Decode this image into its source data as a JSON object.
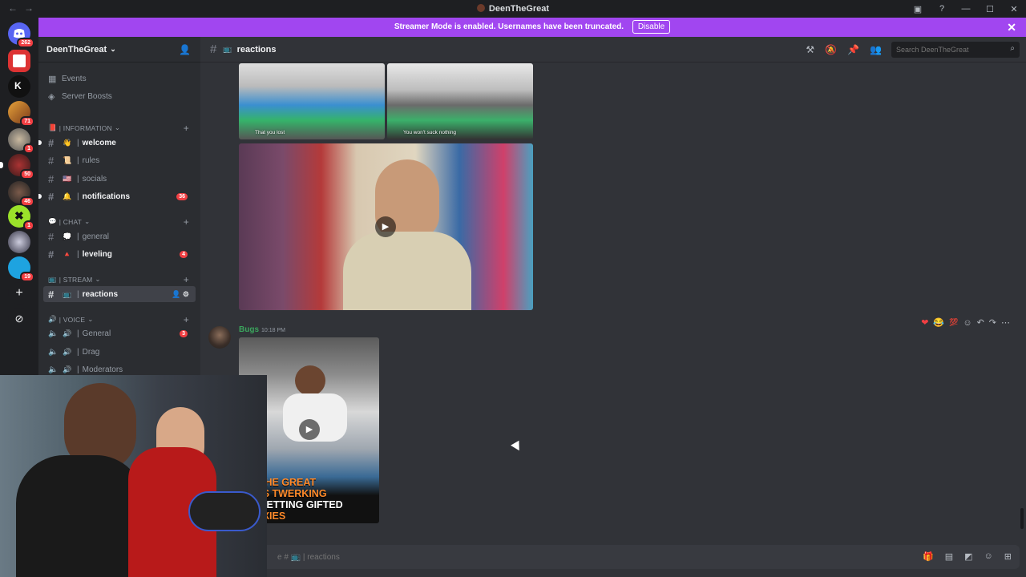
{
  "window": {
    "title": "DeenTheGreat",
    "nav_back": "←",
    "nav_forward": "→"
  },
  "banner": {
    "text": "Streamer Mode is enabled. Usernames have been truncated.",
    "button": "Disable",
    "close": "✕"
  },
  "guilds": [
    {
      "badge": "262"
    },
    {
      "badge": ""
    },
    {
      "badge": ""
    },
    {
      "badge": "71"
    },
    {
      "badge": "1"
    },
    {
      "badge": "50"
    },
    {
      "badge": "46"
    },
    {
      "badge": "1"
    },
    {
      "badge": ""
    },
    {
      "badge": "19"
    }
  ],
  "server": {
    "name": "DeenTheGreat",
    "items": [
      {
        "label": "Events"
      },
      {
        "label": "Server Boosts"
      }
    ],
    "categories": [
      {
        "label": "| INFORMATION",
        "emoji": "📕"
      },
      {
        "label": "| CHAT",
        "emoji": "💬"
      },
      {
        "label": "| STREAM",
        "emoji": "📺"
      },
      {
        "label": "| VOICE",
        "emoji": "🔊"
      }
    ],
    "channels": [
      {
        "name": "welcome",
        "emoji": "👋",
        "prefix": "|"
      },
      {
        "name": "rules",
        "emoji": "📜",
        "prefix": "|"
      },
      {
        "name": "socials",
        "emoji": "🇺🇸",
        "prefix": "|"
      },
      {
        "name": "notifications",
        "emoji": "🔔",
        "prefix": "|",
        "badge": "36"
      },
      {
        "name": "general",
        "emoji": "💭",
        "prefix": "|"
      },
      {
        "name": "leveling",
        "emoji": "🔺",
        "prefix": "|",
        "badge": "4"
      },
      {
        "name": "reactions",
        "emoji": "📺",
        "prefix": "|"
      }
    ],
    "voice": [
      {
        "name": "General",
        "prefix": "|",
        "badge": "3"
      },
      {
        "name": "Drag",
        "prefix": "|"
      },
      {
        "name": "Moderators",
        "prefix": "|"
      }
    ]
  },
  "channel_header": {
    "name": "reactions",
    "emoji": "📺"
  },
  "search": {
    "placeholder": "Search DeenTheGreat"
  },
  "media": {
    "caption_left": "That you lost",
    "caption_right": "You won't suck nothing"
  },
  "message": {
    "author": "Bugs",
    "time": "10:18 PM",
    "video_text_lines": [
      "EN THE GREAT",
      "ARTS TWERKING",
      "ER GETTING GIFTED",
      "ALAXIES"
    ]
  },
  "composer": {
    "placeholder": "e # 📺 | reactions"
  }
}
